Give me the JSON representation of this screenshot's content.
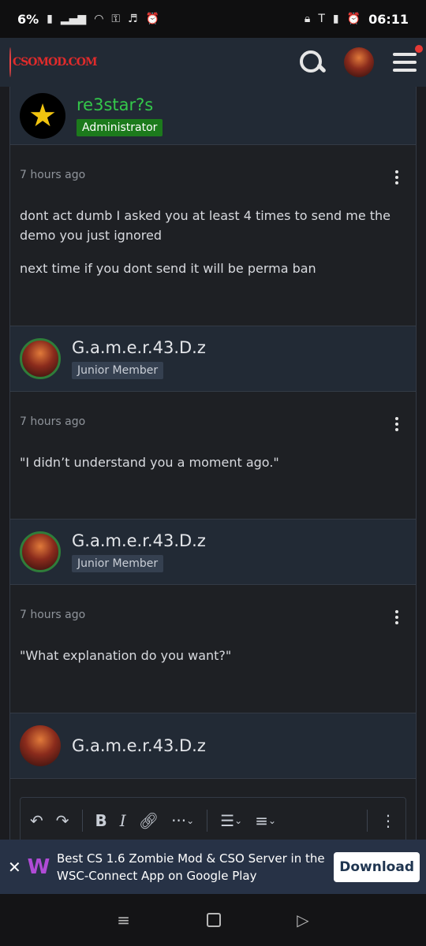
{
  "status": {
    "battery": "6%",
    "time": "06:11"
  },
  "site": {
    "logo_text": "CSOMOD.COM"
  },
  "posts": [
    {
      "author": "re3star?s",
      "role": "Administrator",
      "time": "7 hours ago",
      "paragraphs": [
        "dont act dumb I asked you at least 4 times to send me the demo you just ignored",
        "next time if you dont send it will be perma ban"
      ]
    },
    {
      "author": "G.a.m.e.r.43.D.z",
      "role": "Junior Member",
      "time": "7 hours ago",
      "paragraphs": [
        "\"I didn’t understand you a moment ago.\""
      ]
    },
    {
      "author": "G.a.m.e.r.43.D.z",
      "role": "Junior Member",
      "time": "7 hours ago",
      "paragraphs": [
        "\"What explanation do you want?\""
      ]
    }
  ],
  "reply": {
    "author": "G.a.m.e.r.43.D.z"
  },
  "editor": {
    "bold": "B",
    "italic": "I",
    "more": "···"
  },
  "ad": {
    "logo": "W",
    "text": "Best CS 1.6 Zombie Mod & CSO Server in the WSC-Connect App on Google Play",
    "button": "Download"
  },
  "icons": {
    "search": "search-icon",
    "menu": "hamburger-menu-icon",
    "post_menu": "vertical-dots-icon",
    "close": "close-icon",
    "undo": "undo-icon",
    "redo": "redo-icon",
    "link": "link-icon",
    "list": "list-icon",
    "align": "align-icon"
  },
  "colors": {
    "admin_name": "#34c84a",
    "admin_badge": "#1c7a1c",
    "header_bg": "#222a35",
    "notification_dot": "#e53935"
  }
}
